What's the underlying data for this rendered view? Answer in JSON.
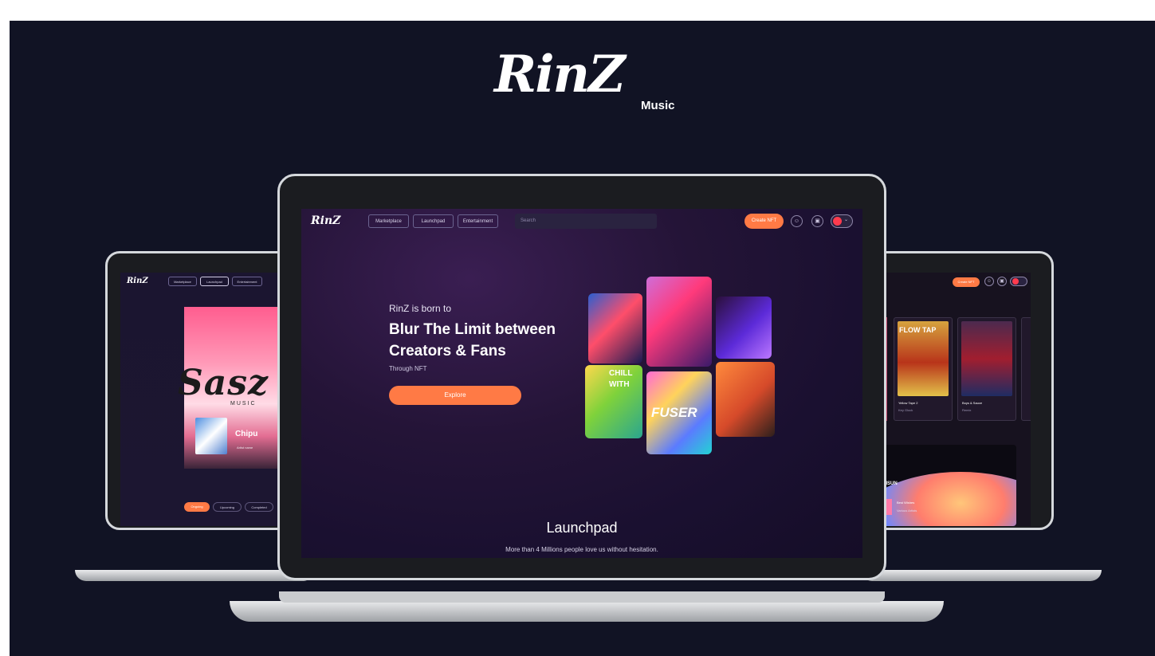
{
  "brand": {
    "logo": "RinZ",
    "sub": "Music"
  },
  "colors": {
    "accent": "#ff7a45",
    "background": "#111324"
  },
  "main": {
    "nav": {
      "logo": "RinZ",
      "items": [
        "Marketplace",
        "Launchpad",
        "Entertainment"
      ],
      "search_placeholder": "Search",
      "create_label": "Create NFT"
    },
    "hero": {
      "intro": "RinZ is born to",
      "title": "Blur The Limit between Creators & Fans",
      "subtitle": "Through NFT",
      "cta": "Explore"
    },
    "tiles": [
      {
        "text": ""
      },
      {
        "text": ""
      },
      {
        "text": ""
      },
      {
        "text": "CHILL WITH"
      },
      {
        "text": "FUSER"
      },
      {
        "text": ""
      }
    ],
    "section": {
      "title": "Launchpad",
      "subtitle": "More than 4 Millions people love us without hesitation."
    }
  },
  "left": {
    "nav": {
      "logo": "RinZ",
      "items": [
        "Marketplace",
        "Launchpad",
        "Entertainment"
      ]
    },
    "banner": {
      "title": "Sasz",
      "music": "MUSIC",
      "artist": "Chipu",
      "meta": "Artist name"
    },
    "tabs": [
      "Ongoing",
      "Upcoming",
      "Completed"
    ]
  },
  "right": {
    "create_label": "Create NFT",
    "cards": [
      {
        "title": "Yellow Tape 2",
        "artist": "Key Glock"
      },
      {
        "title": "Boys & Sauce",
        "artist": "Remix"
      }
    ],
    "cover_text": "FLOW TAP",
    "now_playing": {
      "title": "Best Wishes",
      "artist": "Various Artists"
    },
    "art_label": "RISUN"
  }
}
